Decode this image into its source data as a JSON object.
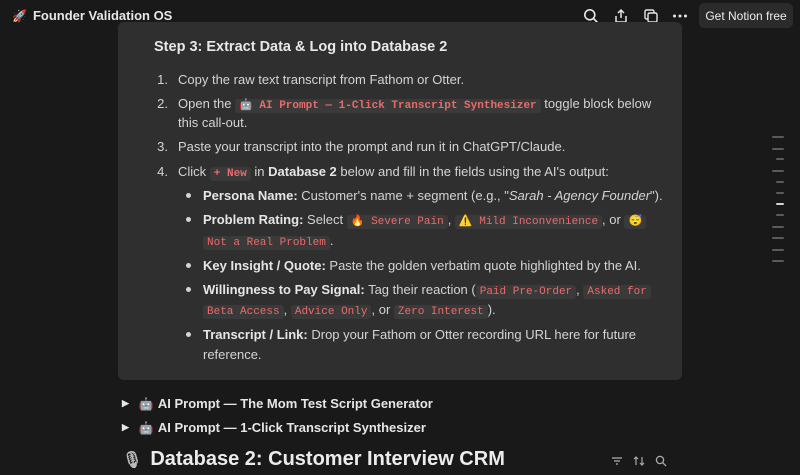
{
  "topbar": {
    "title": "Founder Validation OS",
    "title_icon": "rocket-icon",
    "get_notion_label": "Get Notion free",
    "icons": [
      "search-icon",
      "share-icon",
      "duplicate-icon",
      "more-icon"
    ]
  },
  "callout": {
    "step_title": "Step 3: Extract Data & Log into Database 2",
    "steps": {
      "s1_num": "1.",
      "s1_text": "Copy the raw text transcript from Fathom or Otter.",
      "s2_num": "2.",
      "s2_a": "Open the ",
      "s2_code": "🤖 AI Prompt — 1-Click Transcript Synthesizer",
      "s2_b": " toggle block below",
      "s2_c": "this call-out.",
      "s3_num": "3.",
      "s3_text": "Paste your transcript into the prompt and run it in ChatGPT/Claude.",
      "s4_num": "4.",
      "s4_a": "Click ",
      "s4_code": "+ New",
      "s4_b": " in ",
      "s4_bold": "Database 2",
      "s4_c": " below and fill in the fields using the AI's output:"
    },
    "fields": {
      "persona_label": "Persona Name:",
      "persona_text": " Customer's name + segment (e.g., \"",
      "persona_example": "Sarah - Agency Founder",
      "persona_end": "\").",
      "problem_label": "Problem Rating:",
      "problem_select": " Select ",
      "problem_opt1": "🔥 Severe Pain",
      "problem_opt2": "⚠️ Mild Inconvenience",
      "problem_or": ", or ",
      "problem_opt3_emoji": "😴",
      "problem_opt3": "Not a Real Problem",
      "problem_comma": ", ",
      "problem_end": ".",
      "insight_label": "Key Insight / Quote:",
      "insight_text": " Paste the golden verbatim quote highlighted by the AI.",
      "wtp_label": "Willingness to Pay Signal:",
      "wtp_text": " Tag their reaction (",
      "wtp_opt1": "Paid Pre-Order",
      "wtp_opt2a": "Asked for",
      "wtp_opt2b": "Beta Access",
      "wtp_opt3": "Advice Only",
      "wtp_or": ", or ",
      "wtp_opt4": "Zero Interest",
      "wtp_end": ").",
      "transcript_label": "Transcript / Link:",
      "transcript_text": " Drop your Fathom or Otter recording URL here for future",
      "transcript_text2": "reference."
    }
  },
  "toggles": [
    {
      "label": "AI Prompt — The Mom Test Script Generator"
    },
    {
      "label": "AI Prompt — 1-Click Transcript Synthesizer"
    }
  ],
  "database": {
    "title": "Database 2: Customer Interview CRM",
    "icon": "microphone-icon",
    "actions": [
      "filter-icon",
      "sort-icon",
      "search-icon"
    ]
  }
}
